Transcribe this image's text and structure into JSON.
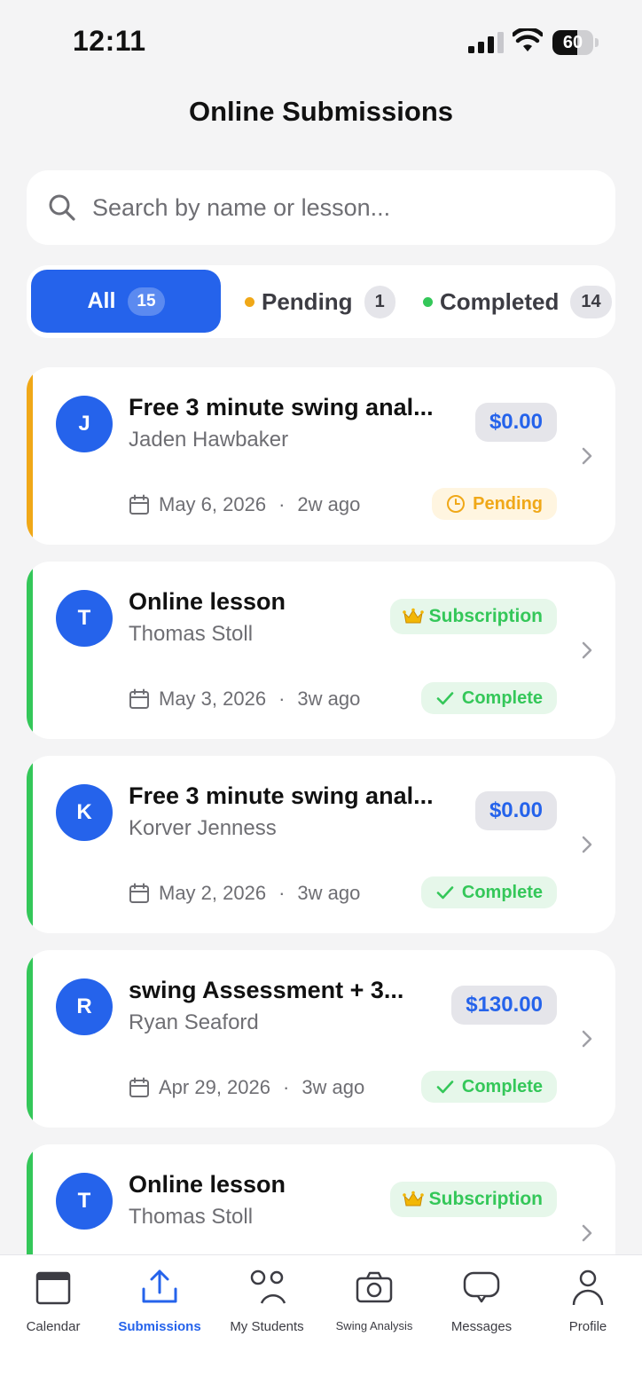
{
  "status_bar": {
    "time": "12:11",
    "battery": "60",
    "battery_level": 0.6
  },
  "page": {
    "title": "Online Submissions"
  },
  "search": {
    "placeholder": "Search by name or lesson..."
  },
  "filters": {
    "all": {
      "label": "All",
      "count": "15"
    },
    "pending": {
      "label": "Pending",
      "count": "1",
      "dot_color": "#f0a818"
    },
    "completed": {
      "label": "Completed",
      "count": "14",
      "dot_color": "#34c759"
    }
  },
  "submissions": [
    {
      "initial": "J",
      "title": "Free 3 minute swing anal...",
      "name": "Jaden Hawbaker",
      "badge_type": "price",
      "price": "$0.00",
      "date": "May 6, 2026",
      "ago": "2w ago",
      "status": "Pending",
      "status_type": "pending",
      "accent": "#f0a818"
    },
    {
      "initial": "T",
      "title": "Online lesson",
      "name": "Thomas Stoll",
      "badge_type": "subscription",
      "badge_label": "Subscription",
      "date": "May 3, 2026",
      "ago": "3w ago",
      "status": "Complete",
      "status_type": "complete",
      "accent": "#34c759"
    },
    {
      "initial": "K",
      "title": "Free 3 minute swing anal...",
      "name": "Korver Jenness",
      "badge_type": "price",
      "price": "$0.00",
      "date": "May 2, 2026",
      "ago": "3w ago",
      "status": "Complete",
      "status_type": "complete",
      "accent": "#34c759"
    },
    {
      "initial": "R",
      "title": "swing Assessment + 3...",
      "name": "Ryan Seaford",
      "badge_type": "price",
      "price": "$130.00",
      "date": "Apr 29, 2026",
      "ago": "3w ago",
      "status": "Complete",
      "status_type": "complete",
      "accent": "#34c759"
    },
    {
      "initial": "T",
      "title": "Online lesson",
      "name": "Thomas Stoll",
      "badge_type": "subscription",
      "badge_label": "Subscription",
      "date": "",
      "ago": "",
      "status": "",
      "status_type": "complete",
      "accent": "#34c759"
    }
  ],
  "tab_bar": {
    "items": [
      {
        "label": "Calendar",
        "icon": "calendar-icon",
        "active": false
      },
      {
        "label": "Submissions",
        "icon": "upload-icon",
        "active": true
      },
      {
        "label": "My Students",
        "icon": "students-icon",
        "active": false
      },
      {
        "label": "Swing Analysis",
        "icon": "camera-icon",
        "active": false
      },
      {
        "label": "Messages",
        "icon": "message-icon",
        "active": false
      },
      {
        "label": "Profile",
        "icon": "profile-icon",
        "active": false
      }
    ]
  },
  "colors": {
    "accent": "#2563eb",
    "pending": "#f0a818",
    "complete": "#34c759"
  }
}
